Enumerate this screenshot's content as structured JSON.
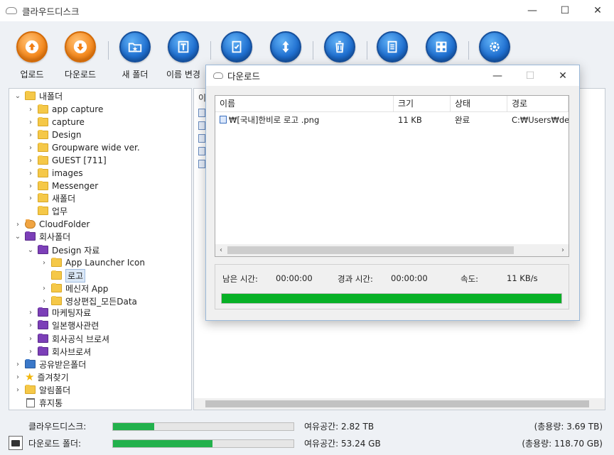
{
  "window": {
    "title": "클라우드디스크",
    "minimize": "—",
    "maximize": "☐",
    "close": "✕"
  },
  "toolbar": {
    "upload": "업로드",
    "download": "다운로드",
    "new_folder": "새 폴더",
    "rename": "이름 변경"
  },
  "tree": {
    "my_folder": "내폴더",
    "app_capture": "app capture",
    "capture": "capture",
    "design": "Design",
    "groupware": "Groupware wide ver.",
    "guest": "GUEST [711]",
    "images": "images",
    "messenger": "Messenger",
    "new_folder": "새폴더",
    "work": "업무",
    "cloud_folder": "CloudFolder",
    "company_folder": "회사폴더",
    "design_data": "Design 자료",
    "app_launcher": "App Launcher Icon",
    "logo": "로고",
    "messenger_app": "메신저 App",
    "video_edit": "영상편집_모든Data",
    "marketing": "마케팅자료",
    "japan_event": "일본행사관련",
    "company_brochure": "회사공식 브로셔",
    "brochure": "회사브로셔",
    "shared_folder": "공유받은폴더",
    "favorites": "즐겨찾기",
    "notification_folder": "알림폴더",
    "trash": "휴지통"
  },
  "filelist": {
    "header_partial": "이"
  },
  "dialog": {
    "title": "다운로드",
    "columns": {
      "name": "이름",
      "size": "크기",
      "status": "상태",
      "path": "경로"
    },
    "row": {
      "name": "₩[국내]한비로 로고 .png",
      "size": "11 KB",
      "status": "완료",
      "path": "C:₩Users₩design"
    },
    "info": {
      "remaining_label": "남은 시간:",
      "remaining_value": "00:00:00",
      "elapsed_label": "경과 시간:",
      "elapsed_value": "00:00:00",
      "speed_label": "속도:",
      "speed_value": "11 KB/s",
      "progress": 1.0
    }
  },
  "status": {
    "cloud_label": "클라우드디스크:",
    "cloud_used_fraction": 0.23,
    "cloud_free": "여유공간: 2.82 TB",
    "cloud_total": "(총용량: 3.69 TB)",
    "download_label": "다운로드 폴더:",
    "download_used_fraction": 0.55,
    "download_free": "여유공간: 53.24 GB",
    "download_total": "(총용량: 118.70 GB)"
  },
  "colors": {
    "progress_green": "#06b025",
    "disk_green": "#22b14c",
    "toolbar_orange": "#f58a1f",
    "toolbar_blue": "#1f6fd0",
    "folder_purple": "#7c3fb8",
    "folder_yellow": "#f5c848"
  }
}
